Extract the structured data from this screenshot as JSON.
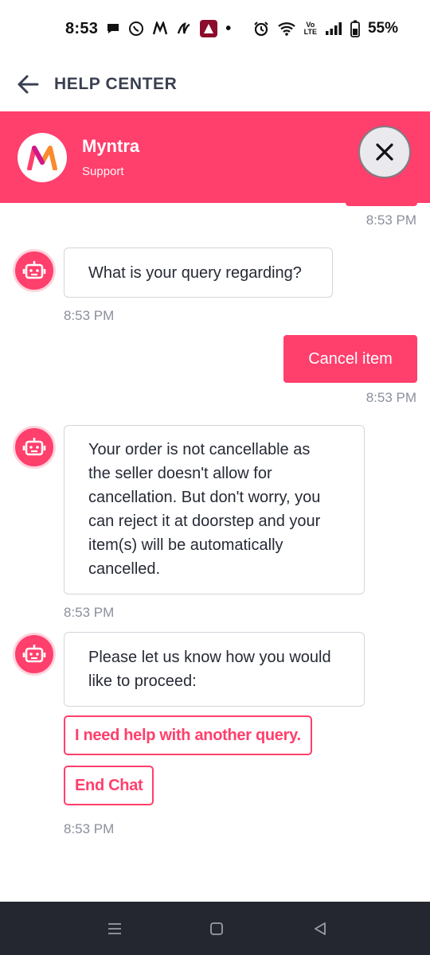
{
  "status_bar": {
    "time": "8:53",
    "icons": [
      "chat-icon",
      "whatsapp-icon",
      "myntra-icon",
      "app-icon",
      "app-box-icon",
      "dot"
    ],
    "lte_label": "Vo\nLTE",
    "battery_pct": "55%"
  },
  "app_bar": {
    "title": "HELP CENTER"
  },
  "header": {
    "brand_name": "Myntra",
    "brand_sub": "Support",
    "bg_color": "#ff3f6c"
  },
  "messages": [
    {
      "from": "user",
      "time": "8:53 PM"
    },
    {
      "from": "bot",
      "text": "What is your query regarding?",
      "time": "8:53 PM"
    },
    {
      "from": "user",
      "text": "Cancel item",
      "time": "8:53 PM"
    },
    {
      "from": "bot",
      "lines": [
        "Your order is not cancellable as",
        "the seller doesn't allow for",
        "cancellation. But don't worry, you",
        "can reject it at doorstep and your",
        "item(s) will be automatically",
        "cancelled."
      ],
      "time": "8:53 PM"
    },
    {
      "from": "bot",
      "lines": [
        "Please let us know how you would",
        "like to proceed:"
      ],
      "time": "8:53 PM"
    }
  ],
  "options": [
    {
      "label": "I need help with another query."
    },
    {
      "label": "End Chat"
    }
  ],
  "accent_color": "#ff3f6c"
}
